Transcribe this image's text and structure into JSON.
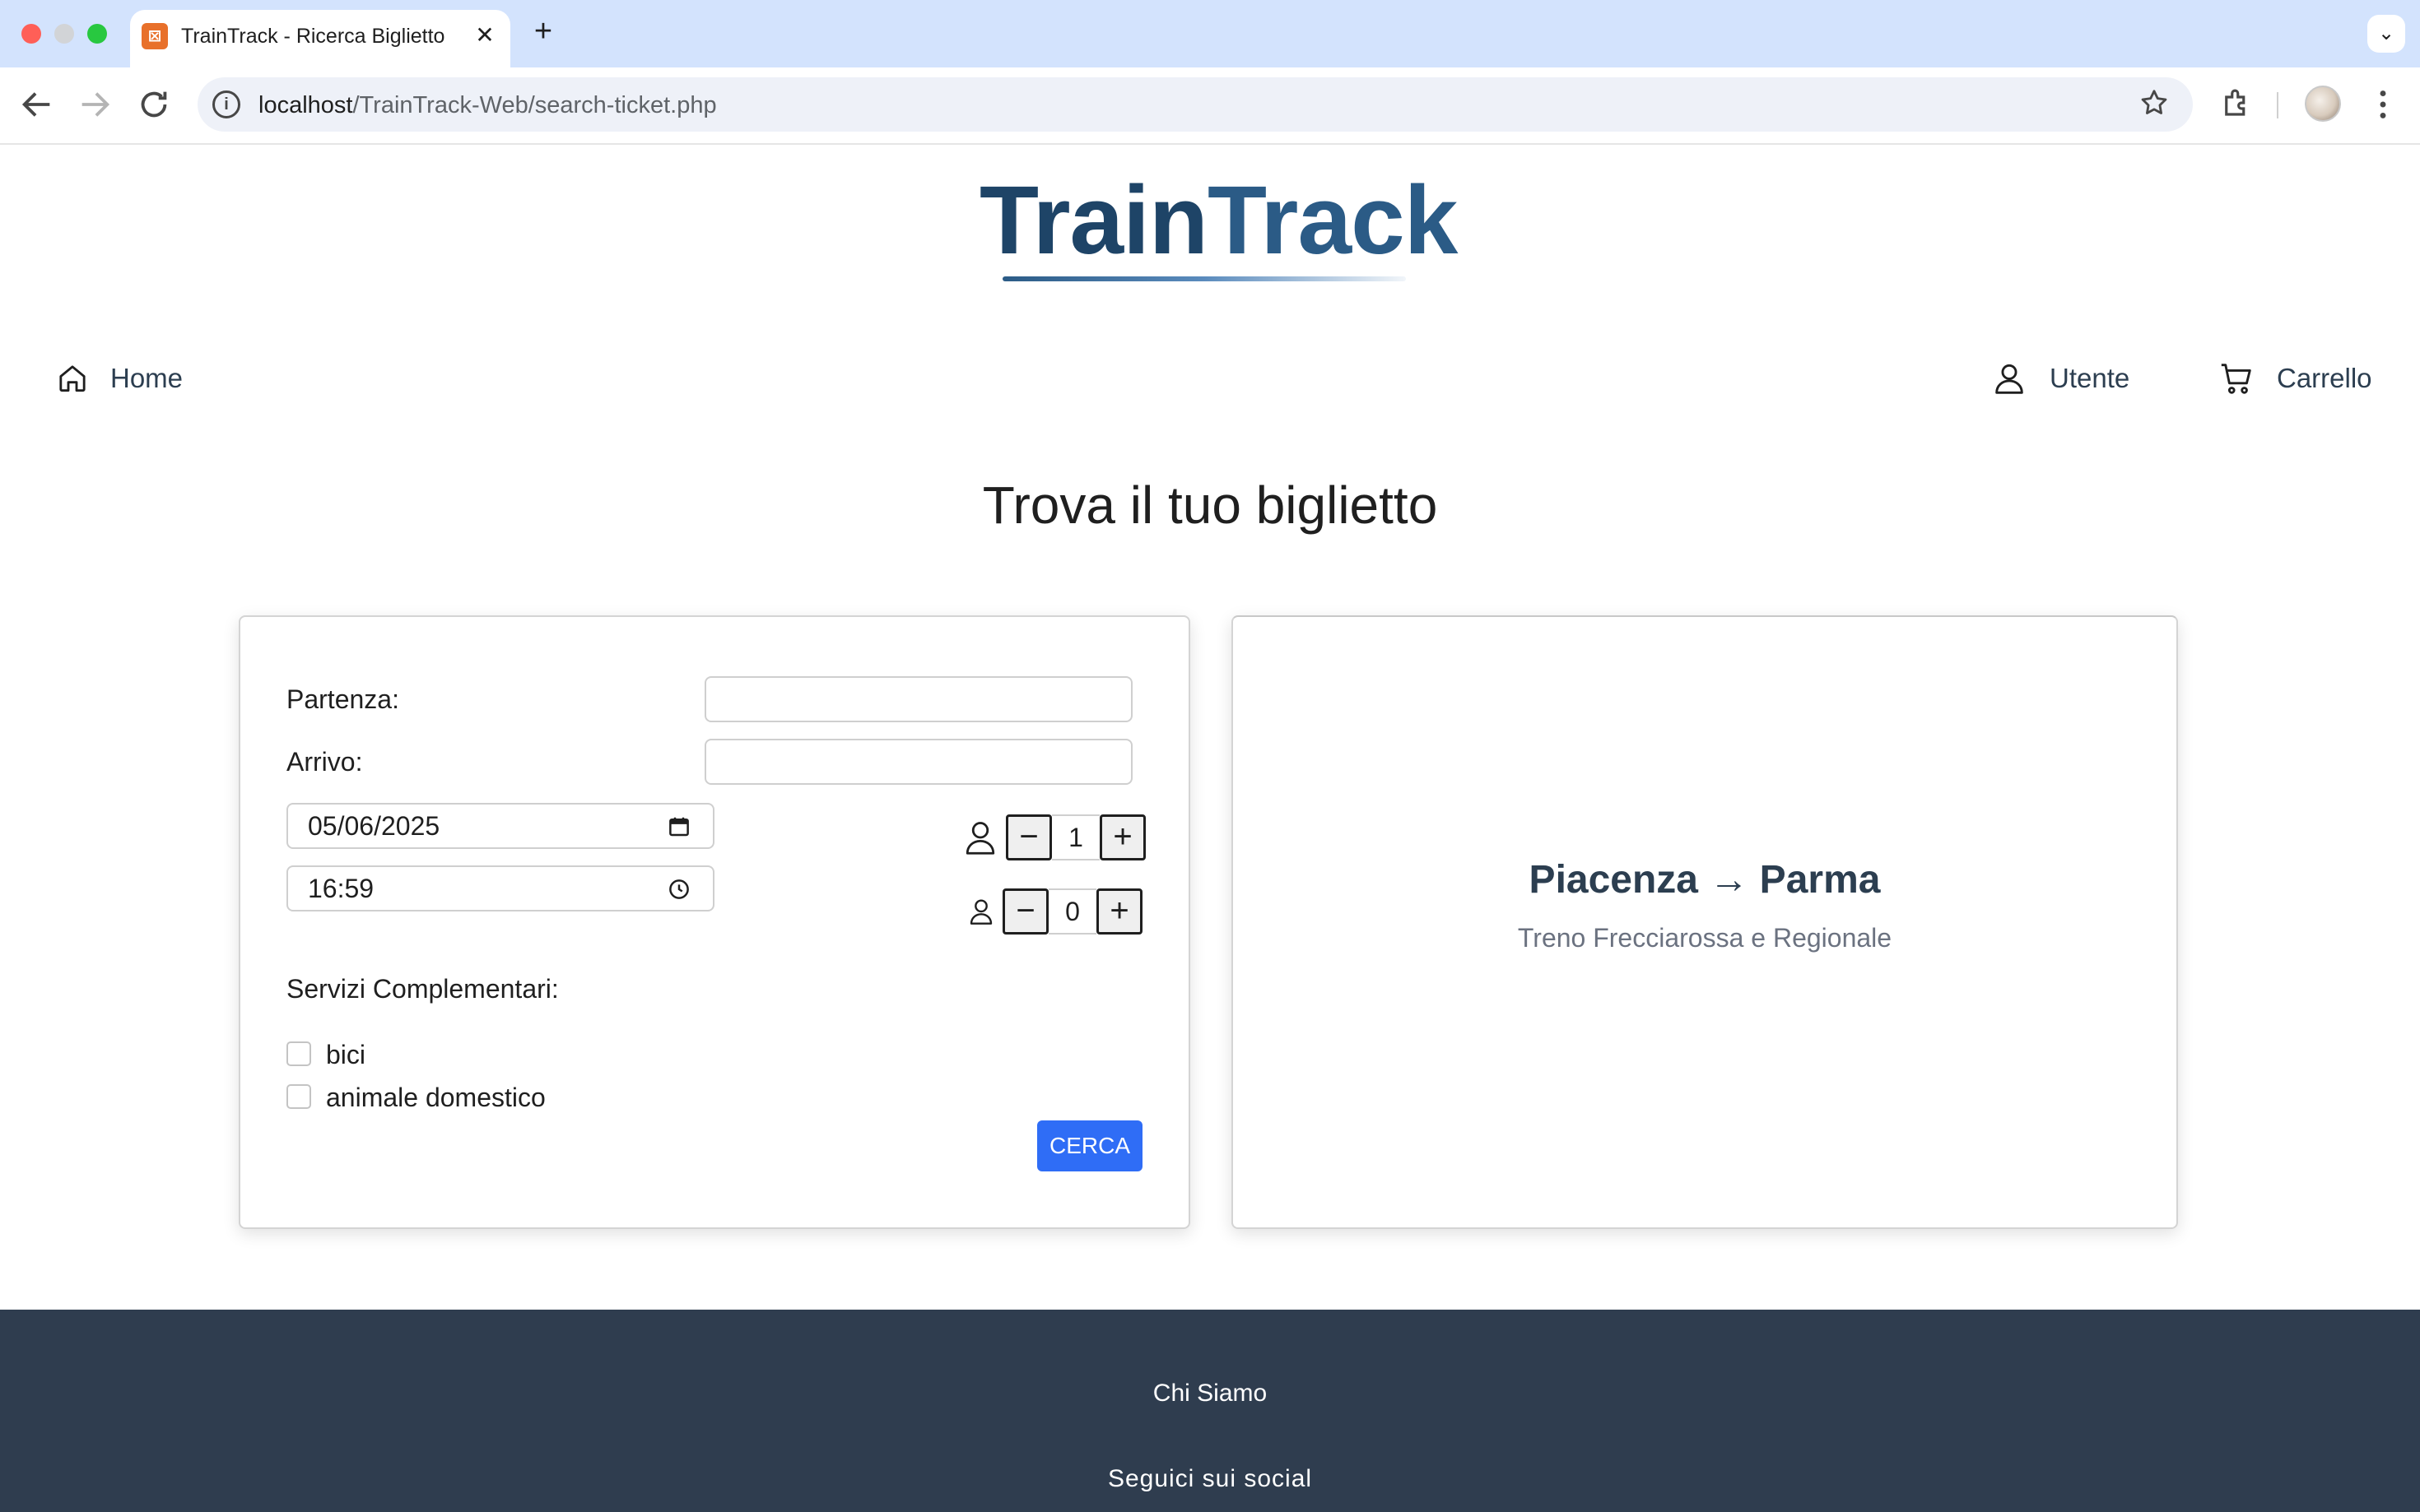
{
  "browser": {
    "tab_title": "TrainTrack - Ricerca Biglietto",
    "tab_close": "✕",
    "new_tab": "+",
    "tab_menu": "⌄",
    "url_host": "localhost",
    "url_path": "/TrainTrack-Web/search-ticket.php",
    "info_glyph": "i",
    "icons": [
      "back-icon",
      "forward-icon",
      "reload-icon",
      "info-icon",
      "star-icon",
      "extensions-icon",
      "profile-avatar",
      "menu-icon"
    ]
  },
  "header": {
    "logo_part1": "Train",
    "logo_part2": "Track",
    "nav": {
      "home": "Home",
      "user": "Utente",
      "cart": "Carrello"
    }
  },
  "main": {
    "title": "Trova il tuo biglietto",
    "form": {
      "departure_label": "Partenza:",
      "departure_value": "",
      "arrival_label": "Arrivo:",
      "arrival_value": "",
      "date_value": "05/06/2025",
      "time_value": "16:59",
      "adults": {
        "minus": "−",
        "value": "1",
        "plus": "+"
      },
      "children": {
        "minus": "−",
        "value": "0",
        "plus": "+"
      },
      "services_label": "Servizi Complementari:",
      "services": [
        {
          "label": "bici",
          "checked": false
        },
        {
          "label": "animale domestico",
          "checked": false
        }
      ],
      "submit_label": "CERCA"
    },
    "info": {
      "route": "Piacenza → Parma",
      "subtitle": "Treno Frecciarossa e Regionale"
    }
  },
  "footer": {
    "about": "Chi Siamo",
    "social": "Seguici sui social"
  },
  "colors": {
    "accent": "#2f6df6",
    "footer_bg": "#2f3d4f",
    "logo_dark": "#1e4467",
    "logo_light": "#2b5b86"
  }
}
